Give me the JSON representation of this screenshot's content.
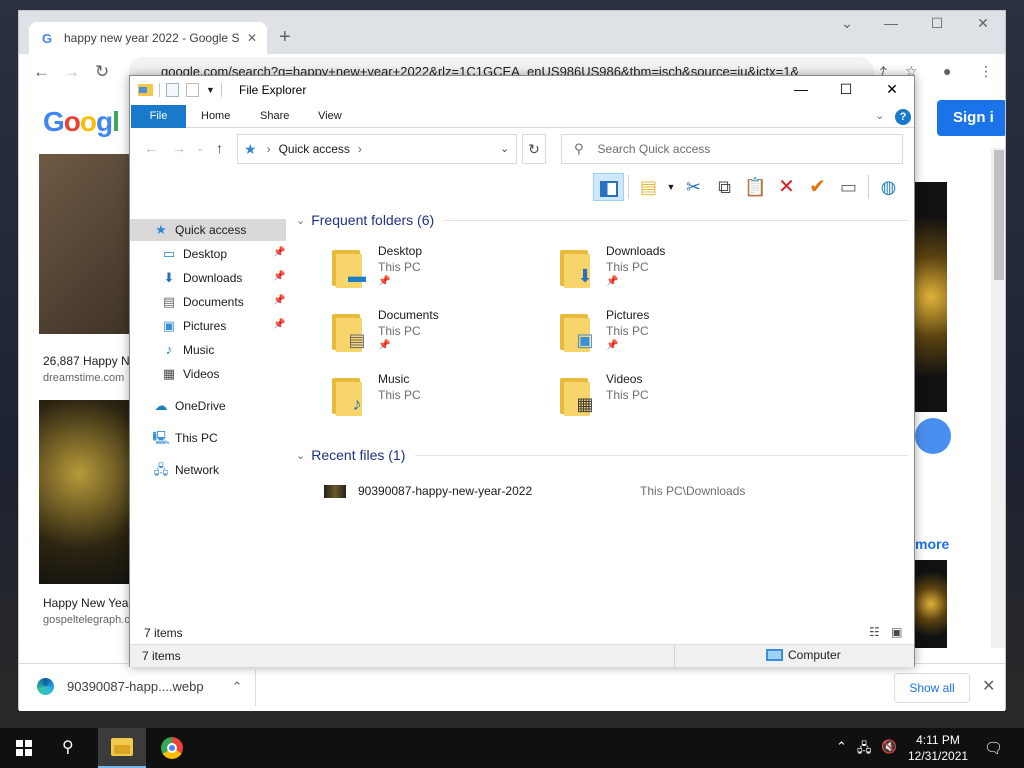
{
  "browser": {
    "tab_title": "happy new year 2022 - Google S",
    "tab_close": "✕",
    "new_tab": "+",
    "url": "google.com/search?q=happy+new+year+2022&rlz=1C1GCEA_enUS986US986&tbm=isch&source=iu&ictx=1&",
    "logo_text": "Google",
    "signin_label": "Sign i",
    "results": [
      {
        "caption": "26,887 Happy N",
        "source": "dreamstime.com"
      },
      {
        "caption": "Happy New Yea",
        "source": "gospeltelegraph.c"
      }
    ],
    "more_label": "more",
    "download": {
      "file": "90390087-happ....webp",
      "show_all": "Show all"
    }
  },
  "explorer": {
    "title": "File Explorer",
    "ribbon_tabs": [
      "File",
      "Home",
      "Share",
      "View"
    ],
    "breadcrumb": "Quick access",
    "search_placeholder": "Search Quick access",
    "nav": [
      {
        "label": "Quick access",
        "icon": "star-icon"
      },
      {
        "label": "Desktop",
        "icon": "desktop-icon",
        "pinned": true
      },
      {
        "label": "Downloads",
        "icon": "download-icon",
        "pinned": true
      },
      {
        "label": "Documents",
        "icon": "document-icon",
        "pinned": true
      },
      {
        "label": "Pictures",
        "icon": "pictures-icon",
        "pinned": true
      },
      {
        "label": "Music",
        "icon": "music-icon"
      },
      {
        "label": "Videos",
        "icon": "videos-icon"
      },
      {
        "label": "OneDrive",
        "icon": "cloud-icon"
      },
      {
        "label": "This PC",
        "icon": "computer-icon"
      },
      {
        "label": "Network",
        "icon": "network-icon"
      }
    ],
    "frequent_header": "Frequent folders (6)",
    "folders": [
      {
        "name": "Desktop",
        "location": "This PC",
        "pinned": true,
        "overlay": "desktop-icon"
      },
      {
        "name": "Downloads",
        "location": "This PC",
        "pinned": true,
        "overlay": "download-arrow-icon"
      },
      {
        "name": "Documents",
        "location": "This PC",
        "pinned": true,
        "overlay": "document-icon"
      },
      {
        "name": "Pictures",
        "location": "This PC",
        "pinned": true,
        "overlay": "picture-icon"
      },
      {
        "name": "Music",
        "location": "This PC",
        "pinned": false,
        "overlay": "music-note-icon"
      },
      {
        "name": "Videos",
        "location": "This PC",
        "pinned": false,
        "overlay": "film-icon"
      }
    ],
    "recent_header": "Recent files (1)",
    "recent_files": [
      {
        "name": "90390087-happy-new-year-2022",
        "location": "This PC\\Downloads"
      }
    ],
    "items_count": "7 items",
    "status_left": "7 items",
    "status_right": "Computer"
  },
  "taskbar": {
    "time": "4:11 PM",
    "date": "12/31/2021"
  },
  "colors": {
    "ribbon_file": "#1979ca",
    "selection": "#d9d9d9",
    "section_header": "#1e3287",
    "close_red": "#e81123",
    "check_orange": "#e3740e"
  }
}
